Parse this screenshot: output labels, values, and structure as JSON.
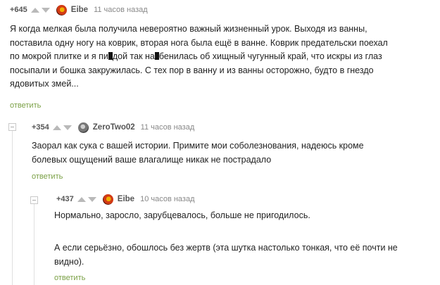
{
  "comments": [
    {
      "rating": "+645",
      "author": "Eibe",
      "time": "11 часов назад",
      "reply_label": "ответить",
      "lines": [
        "Я когда мелкая была получила невероятно важный жизненный урок. Выходя из ванны,",
        "поставила одну ногу на коврик, вторая нога была ещё в ванне. Коврик предательски поехал",
        "по мокрой плитке и я пи_дой так на_бенилась об хищный чугунный край, что искры из глаз",
        "посыпали и бошка закружилась. С тех пор в ванну и из ванны осторожно, будто в гнездо",
        "ядовитых змей..."
      ],
      "line3_parts": [
        "по мокрой плитке и я пи",
        "дой так на",
        "бенилась об хищный чугунный край, что искры из глаз"
      ]
    },
    {
      "rating": "+354",
      "author": "ZeroTwo02",
      "time": "11 часов назад",
      "reply_label": "ответить",
      "lines": [
        "Заорал как сука с вашей истории. Примите мои соболезнования, надеюсь кроме",
        "болевых ощущений ваше влагалище никак не пострадало"
      ]
    },
    {
      "rating": "+437",
      "author": "Eibe",
      "time": "10 часов назад",
      "reply_label": "ответить",
      "paragraph1": "Нормально, заросло, зарубцевалось, больше не пригодилось.",
      "paragraph2_lines": [
        "А если серьёзно, обошлось без жертв (эта шутка настолько тонкая, что её почти не",
        "видно)."
      ]
    }
  ],
  "colors": {
    "reply_link": "#7aa045",
    "meta_text": "#888888",
    "thread_line": "#e0e0e0"
  }
}
